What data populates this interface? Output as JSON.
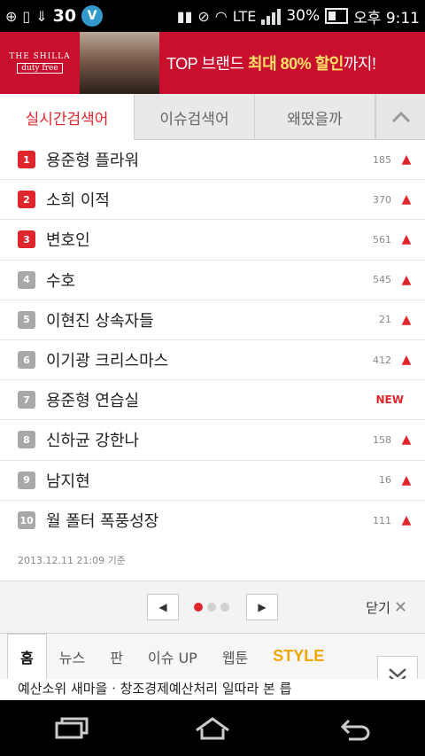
{
  "status_bar": {
    "notification_count": "30",
    "network": "LTE",
    "battery_percent": "30%",
    "time": "오후 9:11",
    "badge_letter": "V"
  },
  "banner": {
    "brand_line1": "THE SHILLA",
    "brand_line2": "duty free",
    "promo_prefix": "TOP 브랜드 ",
    "promo_highlight": "최대 80% 할인",
    "promo_suffix": "까지!"
  },
  "tabs": [
    {
      "label": "실시간검색어",
      "active": true
    },
    {
      "label": "이슈검색어",
      "active": false
    },
    {
      "label": "왜떴을까",
      "active": false
    }
  ],
  "ranking": [
    {
      "rank": "1",
      "keyword": "용준형 플라워",
      "count": "185",
      "trend": "up",
      "top": true
    },
    {
      "rank": "2",
      "keyword": "소희 이적",
      "count": "370",
      "trend": "up",
      "top": true
    },
    {
      "rank": "3",
      "keyword": "변호인",
      "count": "561",
      "trend": "up",
      "top": true
    },
    {
      "rank": "4",
      "keyword": "수호",
      "count": "545",
      "trend": "up",
      "top": false
    },
    {
      "rank": "5",
      "keyword": "이현진 상속자들",
      "count": "21",
      "trend": "up",
      "top": false
    },
    {
      "rank": "6",
      "keyword": "이기광 크리스마스",
      "count": "412",
      "trend": "up",
      "top": false
    },
    {
      "rank": "7",
      "keyword": "용준형 연습실",
      "count": "NEW",
      "trend": "new",
      "top": false
    },
    {
      "rank": "8",
      "keyword": "신하균 강한나",
      "count": "158",
      "trend": "up",
      "top": false
    },
    {
      "rank": "9",
      "keyword": "남지현",
      "count": "16",
      "trend": "up",
      "top": false
    },
    {
      "rank": "10",
      "keyword": "월 폴터 폭풍성장",
      "count": "111",
      "trend": "up",
      "top": false
    }
  ],
  "timestamp": "2013.12.11 21:09 기준",
  "pager": {
    "prev_icon": "◀",
    "next_icon": "▶",
    "close_label": "닫기"
  },
  "bottom_tabs": [
    {
      "label": "홈",
      "active": true
    },
    {
      "label": "뉴스",
      "active": false
    },
    {
      "label": "판",
      "active": false
    },
    {
      "label": "이슈 UP",
      "active": false
    },
    {
      "label": "웹툰",
      "active": false
    },
    {
      "label": "STYLE",
      "active": false
    }
  ],
  "ticker": "예산소위 새마을 · 창조경제예산처리 일따라 본 릅",
  "colors": {
    "accent": "#e0262d",
    "banner": "#c8102e",
    "style": "#f0a800"
  }
}
